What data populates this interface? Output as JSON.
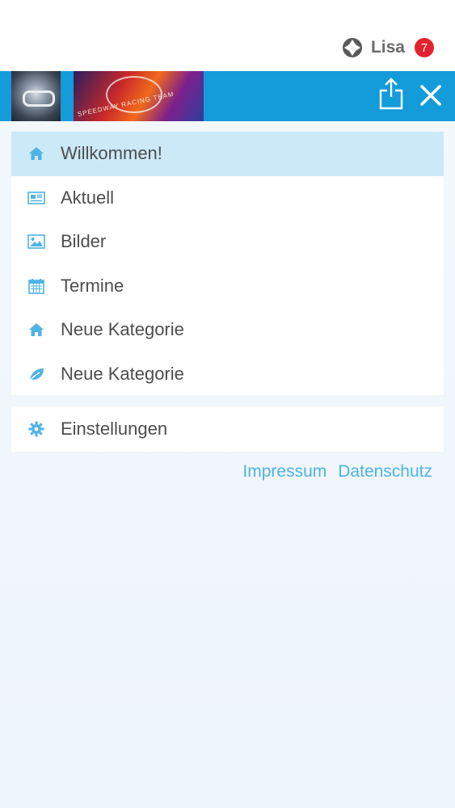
{
  "header": {
    "user_name": "Lisa",
    "notification_count": "7"
  },
  "banner": {
    "image2_caption": "SPEEDWAY RACING TEAM",
    "accent_color": "#149bd9"
  },
  "menu": {
    "items": [
      {
        "label": "Willkommen!",
        "icon": "home-icon",
        "active": true
      },
      {
        "label": "Aktuell",
        "icon": "newspaper-icon",
        "active": false
      },
      {
        "label": "Bilder",
        "icon": "image-icon",
        "active": false
      },
      {
        "label": "Termine",
        "icon": "calendar-icon",
        "active": false
      },
      {
        "label": "Neue Kategorie",
        "icon": "home-icon",
        "active": false
      },
      {
        "label": "Neue Kategorie",
        "icon": "leaf-icon",
        "active": false
      }
    ]
  },
  "settings": {
    "label": "Einstellungen",
    "icon": "gear-icon"
  },
  "footer": {
    "impressum": "Impressum",
    "datenschutz": "Datenschutz"
  },
  "colors": {
    "icon": "#4fb3e3",
    "active_bg": "#cce9f8",
    "badge": "#e2222e"
  }
}
